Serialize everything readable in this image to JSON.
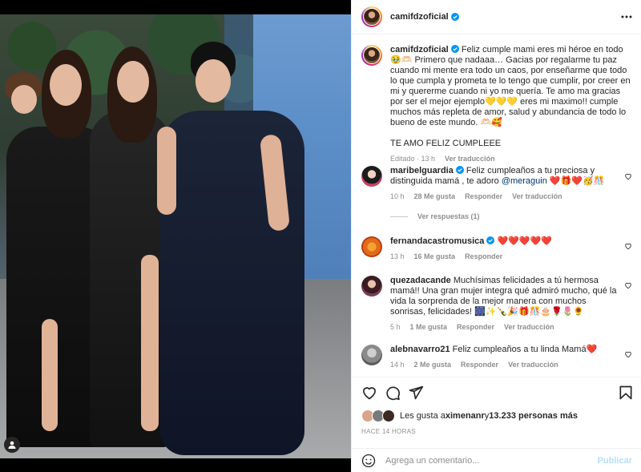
{
  "post": {
    "author": "camifdzoficial",
    "caption_author": "camifdzoficial",
    "caption": "Feliz cumple mami eres mi héroe en todo🥹🫶🏻 Primero que nadaaa… Gacias por regalarme tu paz cuando mi mente era todo un caos, por enseñarme que todo lo que cumpla y prometa te lo tengo que cumplir, por creer en mi y quererme cuando ni yo me quería. Te amo ma gracias por ser el mejor ejemplo💛💛💛 eres mi maximo!! cumple muchos más repleta de amor, salud y abundancia de todo lo bueno de este mundo. 🫶🏻🥰",
    "caption_last": "TE AMO FELIZ CUMPLEEE",
    "caption_meta_time": "Editado · 13 h",
    "caption_meta_translate": "Ver traducción"
  },
  "comments": [
    {
      "user": "maribelguardia",
      "text": "Feliz cumpleaños a tu preciosa y distinguida mamá , te adoro ",
      "mention": "@meraguin",
      "emoji": " ❤️🎁❤️🥳🎊",
      "time": "10 h",
      "likes": "28 Me gusta",
      "reply": "Responder",
      "translate": "Ver traducción",
      "replies": "Ver respuestas (1)"
    },
    {
      "user": "fernandacastromusica",
      "text": "❤️❤️❤️❤️❤️",
      "time": "13 h",
      "likes": "16 Me gusta",
      "reply": "Responder"
    },
    {
      "user": "quezadacande",
      "text": "Muchísimas felicidades a tú hermosa mamá!! Una gran mujer integra qué admiró mucho, qué la vida la sorprenda de la mejor manera con muchos sonrisas, felicidades! 🎆✨🍾🎉🎁🎊🎂🌹🌷🌻",
      "time": "5 h",
      "likes": "1 Me gusta",
      "reply": "Responder",
      "translate": "Ver traducción"
    },
    {
      "user": "alebnavarro21",
      "text": "Feliz cumpleaños a tu linda Mamá❤️",
      "time": "14 h",
      "likes": "2 Me gusta",
      "reply": "Responder",
      "translate": "Ver traducción"
    }
  ],
  "likes": {
    "prefix": "Les gusta a ",
    "user": "ximenanr",
    "middle": " y ",
    "count": "13.233 personas más"
  },
  "timestamp": "HACE 14 HORAS",
  "composer": {
    "placeholder": "Agrega un comentario...",
    "post_label": "Publicar"
  },
  "colors": {
    "verified": "#0095f6",
    "heart": "#ed4956",
    "link": "#00376b",
    "muted": "#8e8e8e"
  },
  "icons": [
    "more-icon",
    "heart-icon",
    "comment-icon",
    "share-icon",
    "bookmark-icon",
    "emoji-icon",
    "user-tag-icon",
    "verified-icon"
  ]
}
